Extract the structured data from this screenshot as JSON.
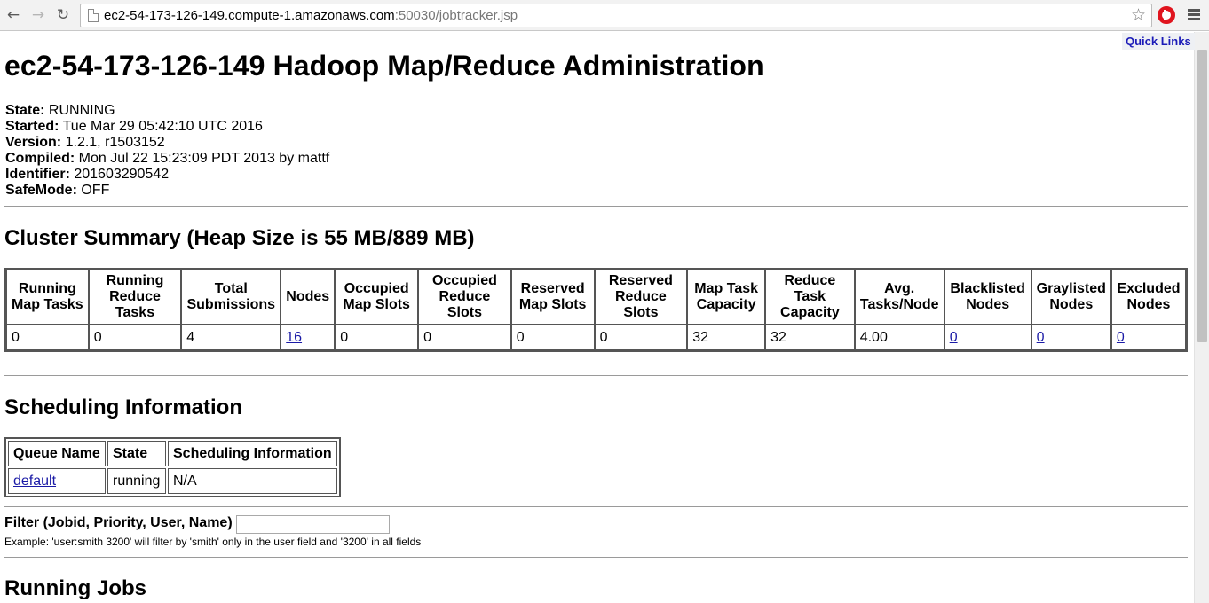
{
  "browser": {
    "url_host": "ec2-54-173-126-149.compute-1.amazonaws.com",
    "url_rest": ":50030/jobtracker.jsp",
    "back_icon": "arrow-left-icon",
    "forward_icon": "arrow-right-icon",
    "reload_icon": "reload-icon",
    "bookmark_icon": "star-icon",
    "extension_icon": "opera-icon",
    "menu_icon": "hamburger-menu-icon"
  },
  "page": {
    "quick_links": "Quick Links",
    "title": "ec2-54-173-126-149 Hadoop Map/Reduce Administration",
    "info": [
      {
        "label": "State:",
        "value": "RUNNING"
      },
      {
        "label": "Started:",
        "value": "Tue Mar 29 05:42:10 UTC 2016"
      },
      {
        "label": "Version:",
        "value": "1.2.1, r1503152"
      },
      {
        "label": "Compiled:",
        "value": "Mon Jul 22 15:23:09 PDT 2013 by mattf"
      },
      {
        "label": "Identifier:",
        "value": "201603290542"
      },
      {
        "label": "SafeMode:",
        "value": "OFF"
      }
    ]
  },
  "cluster_summary": {
    "heading": "Cluster Summary (Heap Size is 55 MB/889 MB)",
    "headers": [
      "Running Map Tasks",
      "Running Reduce Tasks",
      "Total Submissions",
      "Nodes",
      "Occupied Map Slots",
      "Occupied Reduce Slots",
      "Reserved Map Slots",
      "Reserved Reduce Slots",
      "Map Task Capacity",
      "Reduce Task Capacity",
      "Avg. Tasks/Node",
      "Blacklisted Nodes",
      "Graylisted Nodes",
      "Excluded Nodes"
    ],
    "values": [
      "0",
      "0",
      "4",
      "16",
      "0",
      "0",
      "0",
      "0",
      "32",
      "32",
      "4.00",
      "0",
      "0",
      "0"
    ]
  },
  "scheduling": {
    "heading": "Scheduling Information",
    "headers": [
      "Queue Name",
      "State",
      "Scheduling Information"
    ],
    "rows": [
      [
        "default",
        "running",
        "N/A"
      ]
    ]
  },
  "filter": {
    "label": "Filter (Jobid, Priority, User, Name)",
    "value": "",
    "example": "Example: 'user:smith 3200' will filter by 'smith' only in the user field and '3200' in all fields"
  },
  "running_jobs": {
    "heading": "Running Jobs"
  }
}
